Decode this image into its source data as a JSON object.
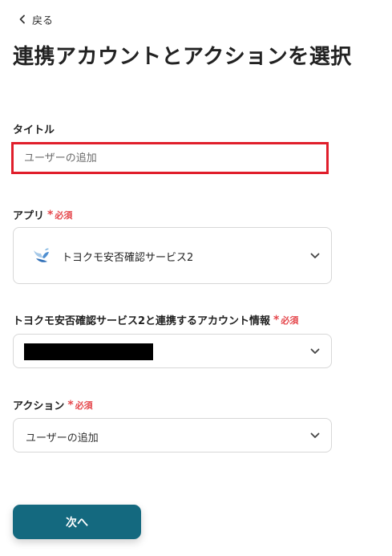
{
  "nav": {
    "back_label": "戻る"
  },
  "page": {
    "title": "連携アカウントとアクションを選択"
  },
  "form": {
    "required_label": "必須",
    "title_field": {
      "label": "タイトル",
      "value": "",
      "placeholder": "ユーザーの追加",
      "highlight_color": "#e01e2b"
    },
    "app_field": {
      "label": "アプリ",
      "selected_app": "トヨクモ安否確認サービス2",
      "app_icon": "dove-icon"
    },
    "account_field": {
      "label": "トヨクモ安否確認サービス2と連携するアカウント情報",
      "selected_value_redacted": true
    },
    "action_field": {
      "label": "アクション",
      "selected_value": "ユーザーの追加"
    }
  },
  "footer": {
    "next_label": "次へ",
    "accent_color": "#14697f"
  }
}
